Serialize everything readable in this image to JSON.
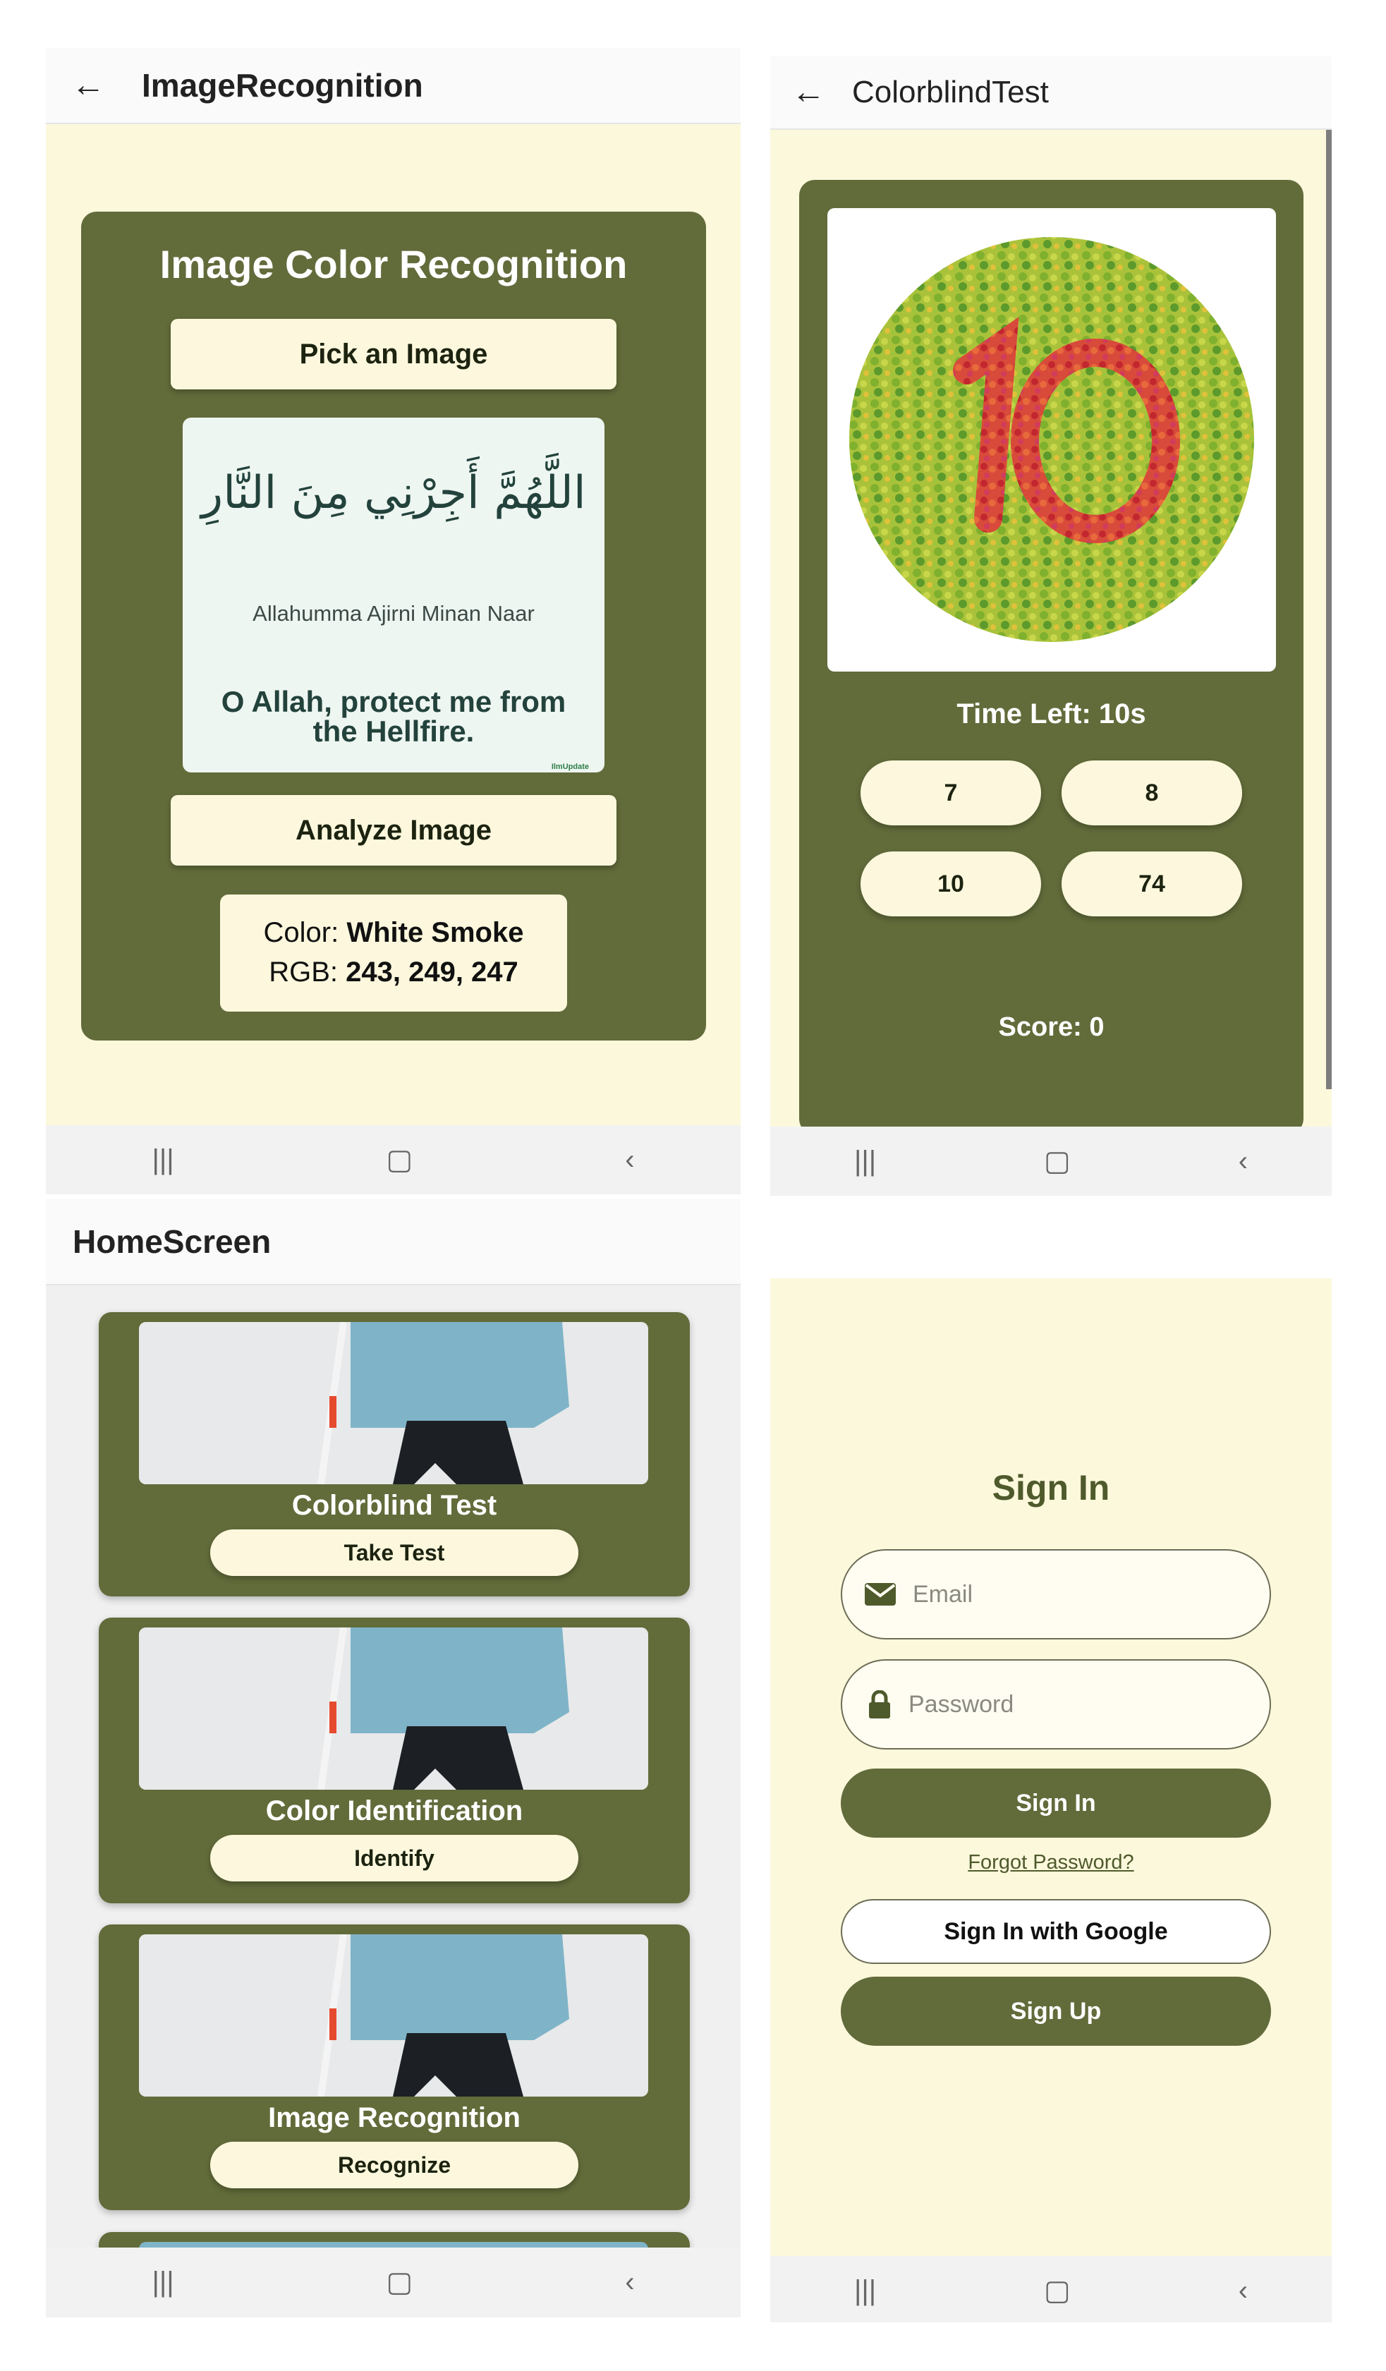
{
  "image_recognition": {
    "title": "ImageRecognition",
    "heading": "Image Color Recognition",
    "pick_label": "Pick an Image",
    "preview": {
      "arabic": "اللَّهُمَّ أَجِرْنِي مِنَ النَّارِ",
      "translit": "Allahumma Ajirni Minan Naar",
      "english": "O Allah, protect me from the Hellfire.",
      "watermark": "IlmUpdate"
    },
    "analyze_label": "Analyze Image",
    "result": {
      "color_label": "Color:",
      "color_value": "White Smoke",
      "rgb_label": "RGB:",
      "rgb_value": "243, 249, 247"
    }
  },
  "colorblind_test": {
    "title": "ColorblindTest",
    "time_left": "Time Left: 10s",
    "options": [
      "7",
      "8",
      "10",
      "74"
    ],
    "score": "Score: 0"
  },
  "home": {
    "title": "HomeScreen",
    "cards": [
      {
        "title": "Colorblind Test",
        "button": "Take Test"
      },
      {
        "title": "Color Identification",
        "button": "Identify"
      },
      {
        "title": "Image Recognition",
        "button": "Recognize"
      }
    ]
  },
  "signin": {
    "heading": "Sign In",
    "email_placeholder": "Email",
    "password_placeholder": "Password",
    "signin_label": "Sign In",
    "forgot_label": "Forgot Password?",
    "google_label": "Sign In with Google",
    "signup_label": "Sign Up",
    "email_icon": "envelope-icon",
    "password_icon": "lock-icon"
  },
  "navbar": {
    "recents": "|||",
    "home": "▢",
    "back": "‹"
  },
  "icons": {
    "back": "←"
  },
  "colors": {
    "olive": "#626b3a",
    "cream": "#fdf8dd",
    "panel_bg": "#fcf8dc"
  }
}
